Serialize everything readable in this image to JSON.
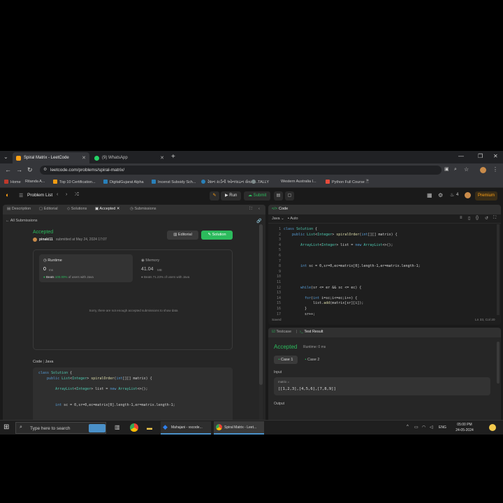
{
  "browser": {
    "tabs": [
      {
        "title": "Spiral Matrix - LeetCode",
        "active": true
      },
      {
        "title": "(9) WhatsApp",
        "active": false
      }
    ],
    "new_tab": "+",
    "window_controls": {
      "minimize": "—",
      "restore": "❐",
      "close": "✕"
    },
    "url": "leetcode.com/problems/spiral-matrix/",
    "bookmarks": [
      {
        "label": "Home",
        "color": "#c0392b"
      },
      {
        "label": "Ritanda   A...",
        "color": "#555555"
      },
      {
        "label": "Top 10 Certification...",
        "color": "#f39c12"
      },
      {
        "label": "DigitalGujarat Alpha",
        "color": "#2980b9"
      },
      {
        "label": "Incenst Subsidy Sch...",
        "color": "#2980b9"
      },
      {
        "label": "રેશન કાર્ડની ઓનલાઇન સેવા | ...",
        "color": "#2980b9"
      },
      {
        "label": "TALLY",
        "color": "#7f8c8d"
      },
      {
        "label": "Western Australia   I...",
        "color": "#444444"
      },
      {
        "label": "Python Full Course ...",
        "color": "#e74c3c"
      }
    ]
  },
  "lc_nav": {
    "problem_list": "Problem List",
    "run": "Run",
    "submit": "Submit",
    "premium": "Premium",
    "streak": "4"
  },
  "left": {
    "tabs": [
      "Description",
      "Editorial",
      "Solutions",
      "Accepted",
      "Submissions"
    ],
    "back_link": "All Submissions",
    "status": "Accepted",
    "user": "pinaki11",
    "submitted": "submitted at May 24, 2024 17:07",
    "editorial_btn": "Editorial",
    "solution_btn": "Solution",
    "runtime": {
      "label": "Runtime",
      "value": "0",
      "unit": "ms",
      "beats_label": "Beats",
      "beats_value": "100.00%",
      "beats_rest": "of users with Java"
    },
    "memory": {
      "label": "Memory",
      "value": "41.04",
      "unit": "MB",
      "beats_label": "Beats",
      "beats_value": "71.23%",
      "beats_rest": "of users with Java"
    },
    "no_data": "Sorry, there are not enough accepted submissions to show data",
    "code_header": "Code",
    "code_lang": "Java",
    "code_lines": [
      "class Solution {",
      "    public List<Integer> spiralOrder(int[][] matrix) {",
      "",
      "        ArrayList<Integer> list = new ArrayList<>();",
      "",
      "",
      "        int sc = 0,sr=0,ec=matrix[0].length-1,er=matrix.length-1;"
    ]
  },
  "editor": {
    "title": "Code",
    "language": "Java",
    "auto": "Auto",
    "line_numbers": [
      "1",
      "2",
      "3",
      "4",
      "5",
      "6",
      "7",
      "8",
      "9",
      "10",
      "11",
      "12",
      "13",
      "14",
      "15",
      "16",
      "17"
    ],
    "lines": [
      "class Solution {",
      "    public List<Integer> spiralOrder(int[][] matrix) {",
      "",
      "        ArrayList<Integer> list = new ArrayList<>();",
      "",
      "",
      "",
      "        int sc = 0,sr=0,ec=matrix[0].length-1,er=matrix.length-1;",
      "",
      "",
      "",
      "        while(sr <= er && sc <= ec) {",
      "",
      "          for(int i=sc;i<=ec;i++) {",
      "              list.add(matrix[sr][i]);",
      "          }",
      "          sr++;"
    ],
    "status_left": "Saved",
    "status_right": "Ln 33, Col 20"
  },
  "result": {
    "testcase_tab": "Testcase",
    "result_tab": "Test Result",
    "status": "Accepted",
    "runtime": "Runtime: 0 ms",
    "case1": "Case 1",
    "case2": "Case 2",
    "input_label": "Input",
    "var_name": "matrix =",
    "input_value": "[[1,2,3],[4,5,6],[7,8,9]]",
    "output_label": "Output"
  },
  "taskbar": {
    "search_placeholder": "Type here to search",
    "apps": [
      {
        "label": "Mahajani - vscode..."
      },
      {
        "label": "Spiral Matrix - Leet..."
      }
    ],
    "lang": "ENG",
    "time": "05:00 PM",
    "date": "24-05-2024"
  },
  "colors": {
    "accepted": "#2cbb5d",
    "premium": "#ffa116",
    "editor_bg": "#1e1e1e",
    "panel_bg": "#262626"
  }
}
